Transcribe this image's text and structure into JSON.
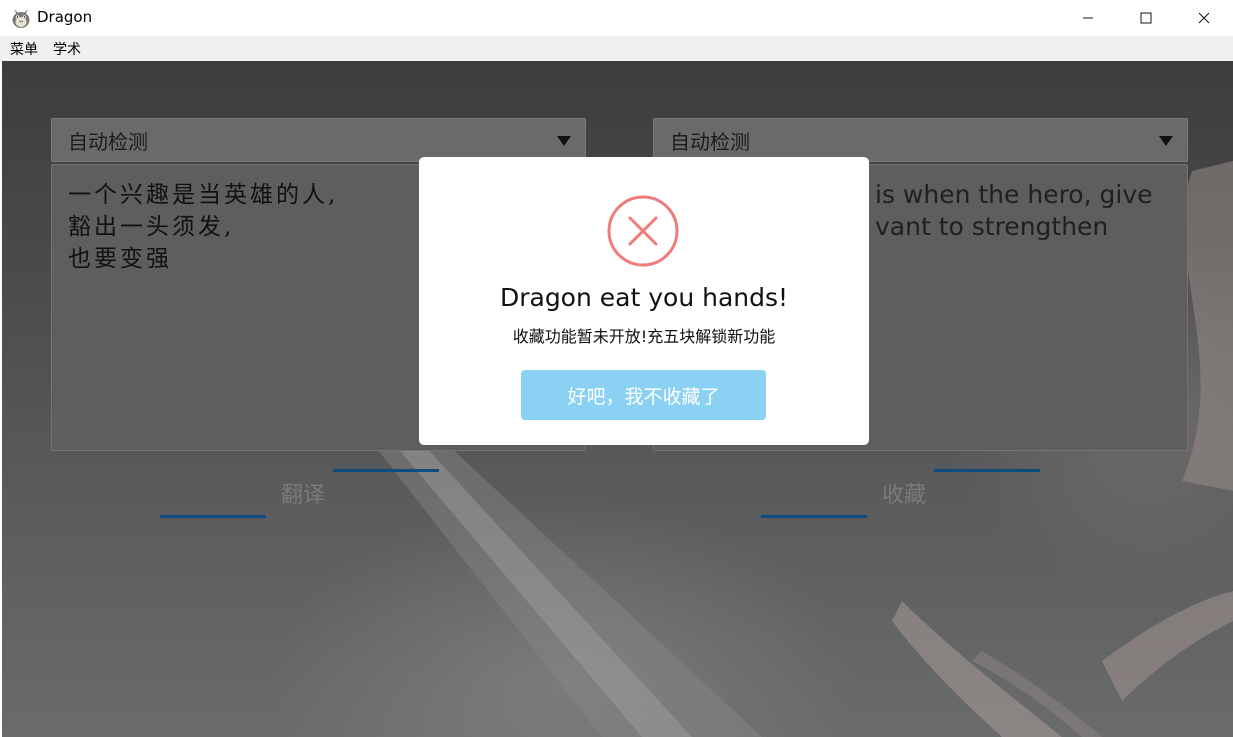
{
  "app": {
    "title": "Dragon",
    "icon": "totoro-app-icon"
  },
  "window_controls": {
    "minimize_icon": "minimize-icon",
    "maximize_icon": "maximize-icon",
    "close_icon": "close-icon"
  },
  "menu": [
    {
      "label": "菜单"
    },
    {
      "label": "学术"
    }
  ],
  "source_panel": {
    "language": "自动检测",
    "lines": [
      "一个兴趣是当英雄的人,",
      "豁出一头须发,",
      "也要变强"
    ],
    "action_label": "翻译"
  },
  "target_panel": {
    "language": "自动检测",
    "lines": [
      "is when the hero, give",
      "vant to strengthen"
    ],
    "action_label": "收藏"
  },
  "dialog": {
    "icon": "error-x-icon",
    "title": "Dragon eat you hands!",
    "message": "收藏功能暂未开放!充五块解锁新功能",
    "button_label": "好吧，我不收藏了"
  },
  "colors": {
    "dialog_button": "#8bd1f4",
    "error_icon": "#f07b7b",
    "accent_line": "#0e4c7d"
  }
}
